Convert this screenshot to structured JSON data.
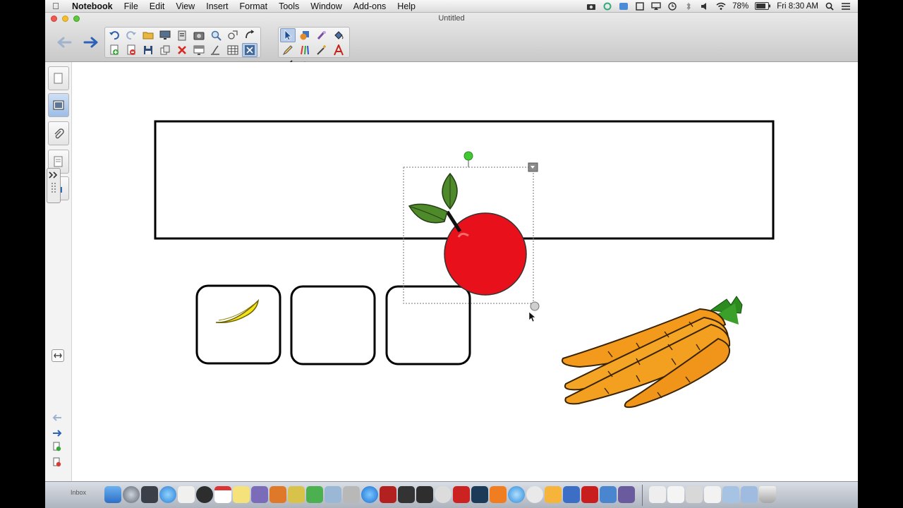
{
  "menubar": {
    "app_name": "Notebook",
    "items": [
      "File",
      "Edit",
      "View",
      "Insert",
      "Format",
      "Tools",
      "Window",
      "Add-ons",
      "Help"
    ],
    "battery": "78%",
    "clock": "Fri 8:30 AM"
  },
  "window": {
    "title": "Untitled"
  },
  "dock": {
    "inbox_label": "Inbox"
  }
}
